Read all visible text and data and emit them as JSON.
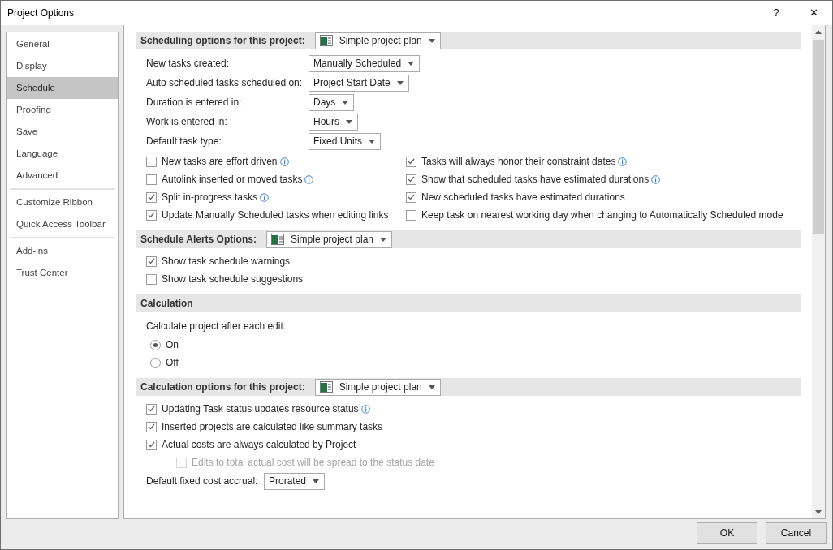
{
  "window": {
    "title": "Project Options",
    "help": "?",
    "close": "✕"
  },
  "sidebar": {
    "groups": [
      [
        {
          "label": "General",
          "selected": false
        },
        {
          "label": "Display",
          "selected": false
        },
        {
          "label": "Schedule",
          "selected": true
        },
        {
          "label": "Proofing",
          "selected": false
        },
        {
          "label": "Save",
          "selected": false
        },
        {
          "label": "Language",
          "selected": false
        },
        {
          "label": "Advanced",
          "selected": false
        }
      ],
      [
        {
          "label": "Customize Ribbon",
          "selected": false
        },
        {
          "label": "Quick Access Toolbar",
          "selected": false
        }
      ],
      [
        {
          "label": "Add-ins",
          "selected": false
        },
        {
          "label": "Trust Center",
          "selected": false
        }
      ]
    ]
  },
  "sections": [
    {
      "title": "Scheduling options for this project:",
      "project": "Simple project plan",
      "items": [
        {
          "kind": "select",
          "label": "New tasks created:",
          "value": "Manually Scheduled"
        },
        {
          "kind": "select",
          "label": "Auto scheduled tasks scheduled on:",
          "value": "Project Start Date"
        },
        {
          "kind": "select",
          "label": "Duration is entered in:",
          "value": "Days"
        },
        {
          "kind": "select",
          "label": "Work is entered in:",
          "value": "Hours"
        },
        {
          "kind": "select",
          "label": "Default task type:",
          "value": "Fixed Units"
        },
        {
          "kind": "check_grid",
          "columns": [
            [
              {
                "label": "New tasks are effort driven",
                "checked": false,
                "info": true
              },
              {
                "label": "Autolink inserted or moved tasks",
                "checked": false,
                "info": true
              },
              {
                "label": "Split in-progress tasks",
                "checked": true,
                "info": true
              },
              {
                "label": "Update Manually Scheduled tasks when editing links",
                "checked": true,
                "info": false
              }
            ],
            [
              {
                "label": "Tasks will always honor their constraint dates",
                "checked": true,
                "info": true
              },
              {
                "label": "Show that scheduled tasks have estimated durations",
                "checked": true,
                "info": true
              },
              {
                "label": "New scheduled tasks have estimated durations",
                "checked": true,
                "info": false
              },
              {
                "label": "Keep task on nearest working day when changing to Automatically Scheduled mode",
                "checked": false,
                "info": false
              }
            ]
          ]
        }
      ]
    },
    {
      "title": "Schedule Alerts Options:",
      "project": "Simple project plan",
      "items": [
        {
          "kind": "check",
          "label": "Show task schedule warnings",
          "checked": true,
          "info": false,
          "disabled": false
        },
        {
          "kind": "check",
          "label": "Show task schedule suggestions",
          "checked": false,
          "info": false,
          "disabled": false
        }
      ]
    },
    {
      "title": "Calculation",
      "items": [
        {
          "kind": "text",
          "label": "Calculate project after each edit:"
        },
        {
          "kind": "radio",
          "label": "On",
          "selected": true
        },
        {
          "kind": "radio",
          "label": "Off",
          "selected": false
        }
      ]
    },
    {
      "title": "Calculation options for this project:",
      "project": "Simple project plan",
      "items": [
        {
          "kind": "check",
          "label": "Updating Task status updates resource status",
          "checked": true,
          "info": true,
          "disabled": false
        },
        {
          "kind": "check",
          "label": "Inserted projects are calculated like summary tasks",
          "checked": true,
          "info": false,
          "disabled": false
        },
        {
          "kind": "check",
          "label": "Actual costs are always calculated by Project",
          "checked": true,
          "info": false,
          "disabled": false,
          "children": [
            {
              "kind": "check",
              "label": "Edits to total actual cost will be spread to the status date",
              "checked": false,
              "info": false,
              "disabled": true
            }
          ]
        },
        {
          "kind": "select",
          "label": "Default fixed cost accrual:",
          "value": "Prorated"
        }
      ]
    }
  ],
  "buttons": [
    "OK",
    "Cancel"
  ]
}
